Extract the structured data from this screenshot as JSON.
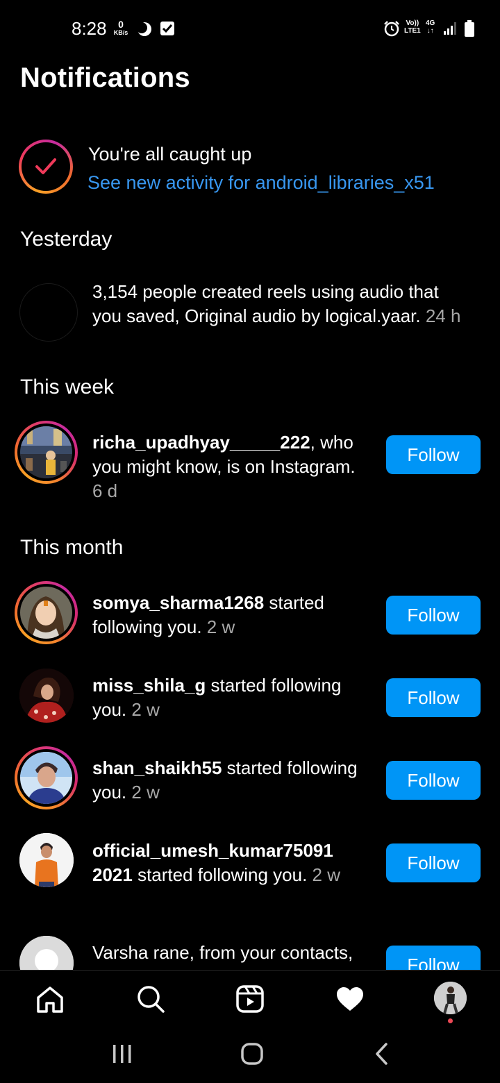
{
  "status_bar": {
    "time": "8:28",
    "speed_value": "0",
    "speed_unit": "KB/s",
    "lte_top": "Vo))",
    "lte_bottom": "LTE1",
    "net_top": "4G",
    "net_bottom": "↓↑"
  },
  "header": {
    "title": "Notifications"
  },
  "caught_up": {
    "title": "You're all caught up",
    "link": "See new activity for android_libraries_x51"
  },
  "sections": {
    "yesterday": "Yesterday",
    "this_week": "This week",
    "this_month": "This month"
  },
  "notifications": [
    {
      "user": "",
      "text": "3,154 people created reels using audio that you saved, Original audio by logical.yaar.",
      "time": "24 h"
    },
    {
      "user": "richa_upadhyay_____222",
      "text": ", who you might know, is on Instagram.",
      "time": "6 d",
      "button": "Follow"
    },
    {
      "user": "somya_sharma1268",
      "text": " started following you.",
      "time": "2 w",
      "button": "Follow"
    },
    {
      "user": "miss_shila_g",
      "text": " started following you.",
      "time": "2 w",
      "button": "Follow"
    },
    {
      "user": "shan_shaikh55",
      "text": " started following you.",
      "time": "2 w",
      "button": "Follow"
    },
    {
      "user": "official_umesh_kumar750912021",
      "text": " started following you.",
      "time": "2 w",
      "button": "Follow"
    },
    {
      "user": "",
      "text": "Varsha rane, from your contacts,",
      "time": "",
      "button": "Follow"
    }
  ],
  "bottom_nav": [
    "home-icon",
    "search-icon",
    "reels-icon",
    "heart-icon",
    "profile-avatar"
  ],
  "colors": {
    "accent": "#0095f6",
    "link": "#3897f0",
    "muted": "#a8a8a8",
    "background": "#000000"
  }
}
